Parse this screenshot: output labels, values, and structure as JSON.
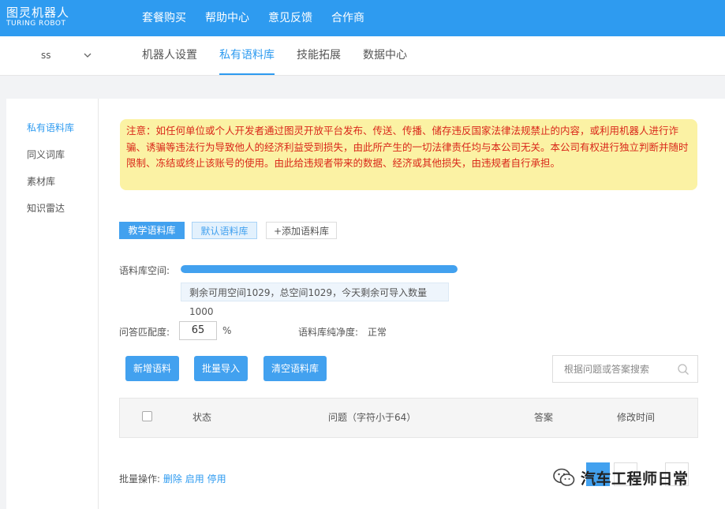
{
  "brand": {
    "name_cn": "图灵机器人",
    "name_en": "TURING ROBOT"
  },
  "top_nav": [
    {
      "label": "套餐购买"
    },
    {
      "label": "帮助中心"
    },
    {
      "label": "意见反馈"
    },
    {
      "label": "合作商"
    }
  ],
  "account": {
    "name": "ss"
  },
  "sub_nav": [
    {
      "label": "机器人设置",
      "active": false
    },
    {
      "label": "私有语料库",
      "active": true
    },
    {
      "label": "技能拓展",
      "active": false
    },
    {
      "label": "数据中心",
      "active": false
    }
  ],
  "sidebar": [
    {
      "label": "私有语料库",
      "active": true
    },
    {
      "label": "同义词库",
      "active": false
    },
    {
      "label": "素材库",
      "active": false
    },
    {
      "label": "知识雷达",
      "active": false
    }
  ],
  "notice": "注意：如任何单位或个人开发者通过图灵开放平台发布、传送、传播、储存违反国家法律法规禁止的内容，或利用机器人进行诈骗、诱骗等违法行为导致他人的经济利益受到损失，由此所产生的一切法律责任均与本公司无关。本公司有权进行独立判断并随时限制、冻结或终止该账号的使用。由此给违规者带来的数据、经济或其他损失，由违规者自行承担。",
  "corpus_tabs": [
    {
      "label": "教学语料库"
    },
    {
      "label": "默认语料库"
    },
    {
      "label": "+添加语料库"
    }
  ],
  "storage": {
    "label": "语料库空间:",
    "used_fraction": 1.0,
    "info": "剩余可用空间1029，总空间1029，今天剩余可导入数量1000"
  },
  "match": {
    "label": "问答匹配度:",
    "value": "65",
    "unit": "%"
  },
  "purity": {
    "label": "语料库纯净度:",
    "value": "正常"
  },
  "actions": [
    {
      "label": "新增语料"
    },
    {
      "label": "批量导入"
    },
    {
      "label": "清空语料库"
    }
  ],
  "search": {
    "placeholder": "根据问题或答案搜索"
  },
  "table": {
    "columns": [
      "状态",
      "问题（字符小于64）",
      "答案",
      "修改时间"
    ]
  },
  "bulk_ops": {
    "label": "批量操作:",
    "items": [
      "删除",
      "启用",
      "停用"
    ]
  },
  "watermark": "汽车工程师日常",
  "colors": {
    "primary": "#2e9bf0",
    "notice_bg": "#fbf2a4",
    "notice_text": "#d9281a"
  }
}
